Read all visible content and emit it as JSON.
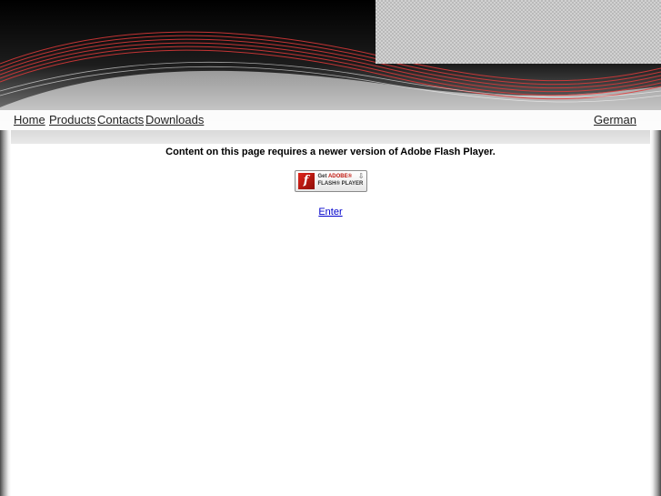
{
  "nav": {
    "items": [
      "Home",
      "Products",
      "Contacts",
      "Downloads"
    ],
    "language": "German"
  },
  "main": {
    "message": "Content on this page requires a newer version of Adobe Flash Player.",
    "badge": {
      "get": "Get",
      "brand": "ADOBE®",
      "product": "FLASH® PLAYER",
      "icon_letter": "f"
    },
    "enter_link": "Enter"
  },
  "colors": {
    "accent_red": "#e0251b",
    "link_blue": "#0000cc"
  },
  "icons": [
    "adobe-flash-icon",
    "download-arrow-icon"
  ]
}
